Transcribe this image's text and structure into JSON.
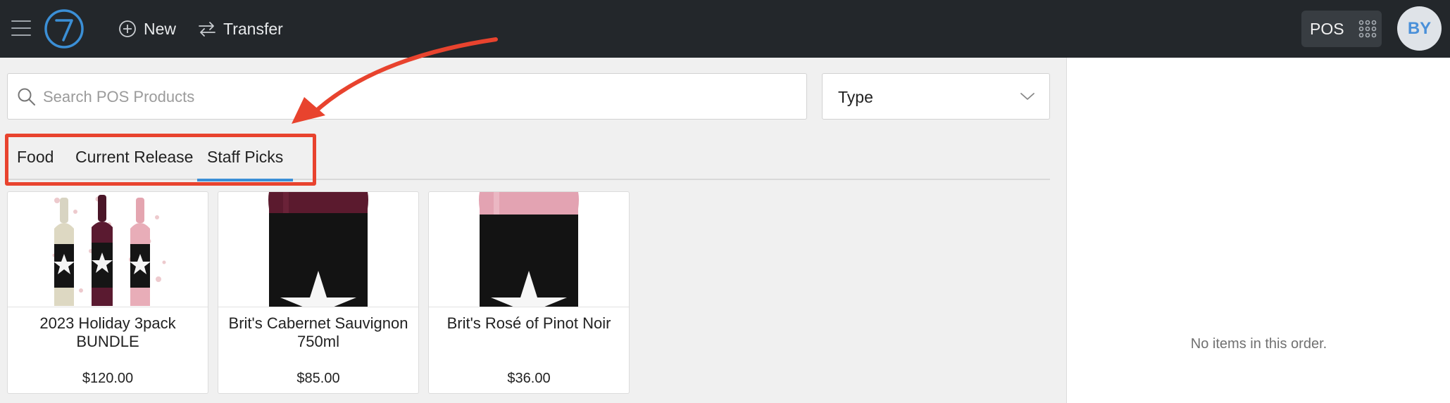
{
  "header": {
    "new_label": "New",
    "transfer_label": "Transfer",
    "pos_label": "POS",
    "avatar_initials": "BY",
    "logo_text": "7"
  },
  "search": {
    "placeholder": "Search POS Products",
    "value": ""
  },
  "type_select": {
    "label": "Type"
  },
  "tabs": [
    {
      "label": "Food",
      "active": false
    },
    {
      "label": "Current Release",
      "active": false
    },
    {
      "label": "Staff Picks",
      "active": true
    }
  ],
  "products": [
    {
      "name": "2023 Holiday 3pack BUNDLE",
      "price": "$120.00"
    },
    {
      "name": "Brit's Cabernet Sauvignon 750ml",
      "price": "$85.00"
    },
    {
      "name": "Brit's Rosé of Pinot Noir",
      "price": "$36.00"
    }
  ],
  "order": {
    "empty_message": "No items in this order."
  },
  "colors": {
    "topbar": "#23272b",
    "accent": "#3b8fd6",
    "annotation": "#e8432e",
    "background": "#f0f0f0"
  },
  "icons": [
    "hamburger-icon",
    "logo-icon",
    "plus-circle-icon",
    "transfer-arrows-icon",
    "apps-grid-icon",
    "search-icon",
    "chevron-down-icon"
  ]
}
